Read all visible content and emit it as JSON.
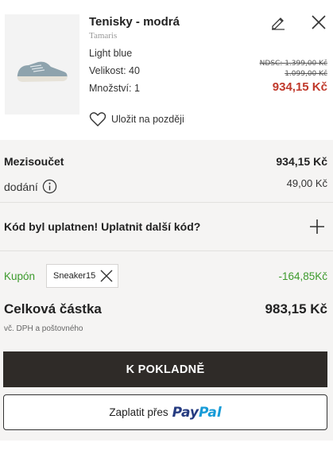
{
  "product": {
    "title": "Tenisky - modrá",
    "brand": "Tamaris",
    "color": "Light blue",
    "size": "Velikost: 40",
    "quantity": "Množství: 1",
    "old_price_1": "NDSC: 1.399,00 Kč",
    "old_price_2": "1.099,00 Kč",
    "price": "934,15 Kč",
    "save_later_label": "Uložit na později",
    "price_color": "#c0392b"
  },
  "summary": {
    "subtotal_label": "Mezisoučet",
    "subtotal_value": "934,15 Kč",
    "delivery_label": "dodání",
    "delivery_value": "49,00 Kč",
    "code_row_label": "Kód byl uplatnen! Uplatnit další kód?",
    "coupon_label": "Kupón",
    "coupon_code": "Sneaker15",
    "coupon_value": "-164,85Kč",
    "coupon_color": "#3c9a2c",
    "total_label": "Celková částka",
    "total_value": "983,15 Kč",
    "total_note": "vč. DPH a poštovného"
  },
  "actions": {
    "checkout_label": "K POKLADNĚ",
    "paypal_prefix": "Zaplatit přes",
    "paypal_logo_1": "Pay",
    "paypal_logo_2": "Pal"
  },
  "icons": {
    "edit": "pencil-icon",
    "remove": "close-icon",
    "wishlist": "heart-icon",
    "info": "info-icon",
    "expand": "plus-icon",
    "remove_coupon": "close-icon"
  }
}
